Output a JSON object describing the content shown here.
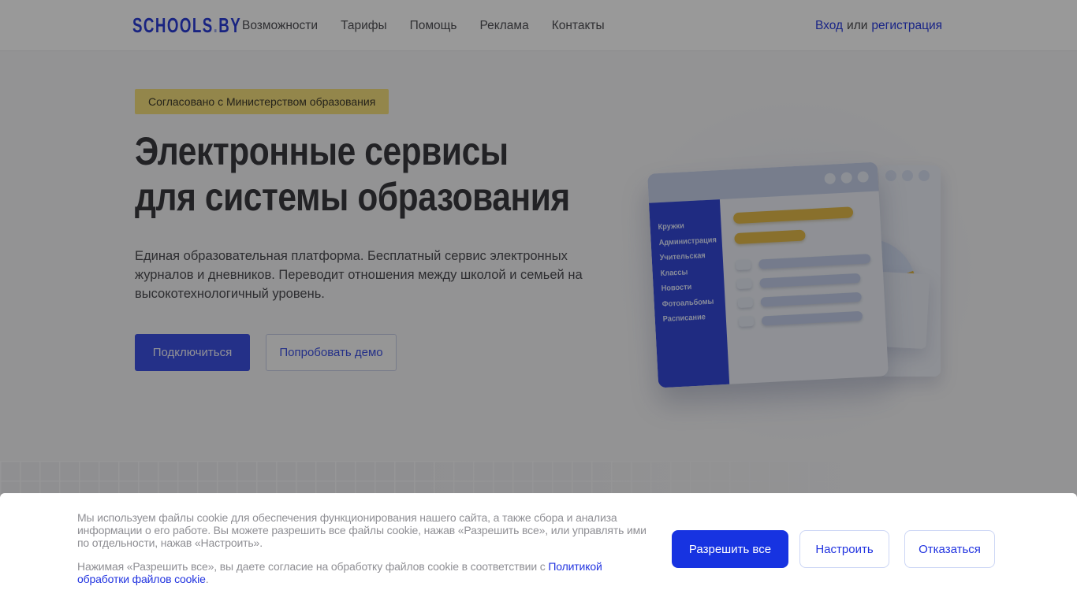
{
  "brand": {
    "name_primary": "SCHOOLS",
    "name_dot": ".",
    "name_suffix": "BY",
    "accent_blue": "#2b3cd8",
    "accent_yellow": "#f6df7d",
    "cookie_button_blue": "#1733e1"
  },
  "nav": {
    "items": [
      "Возможности",
      "Тарифы",
      "Помощь",
      "Реклама",
      "Контакты"
    ],
    "auth": {
      "login": "Вход",
      "or": "или",
      "register": "регистрация"
    }
  },
  "hero": {
    "badge": "Согласовано с Министерством образования",
    "title_line1": "Электронные сервисы",
    "title_line2": "для системы образования",
    "description": "Единая образовательная платформа. Бесплатный сервис электронных журналов и дневников. Переводит отношения между школой и семьей на высокотехнологичный уровень.",
    "primary_button": "Подключиться",
    "secondary_button": "Попробовать демо"
  },
  "illustration": {
    "sidebar_items": [
      "Кружки",
      "Администрация",
      "Учительская",
      "Классы",
      "Новости",
      "Фотоальбомы",
      "Расписание"
    ]
  },
  "cookie_banner": {
    "paragraph1": "Мы используем файлы cookie для обеспечения функционирования нашего сайта, а также сбора и анализа информации о его работе. Вы можете разрешить все файлы cookie, нажав «Разрешить все», или управлять ими по отдельности, нажав «Настроить».",
    "paragraph2_prefix": "Нажимая «Разрешить все», вы даете согласие на обработку файлов cookie в соответствии с ",
    "policy_link": "Политикой обработки файлов cookie",
    "paragraph2_suffix": ".",
    "buttons": [
      "Разрешить все",
      "Настроить",
      "Отказаться"
    ]
  }
}
